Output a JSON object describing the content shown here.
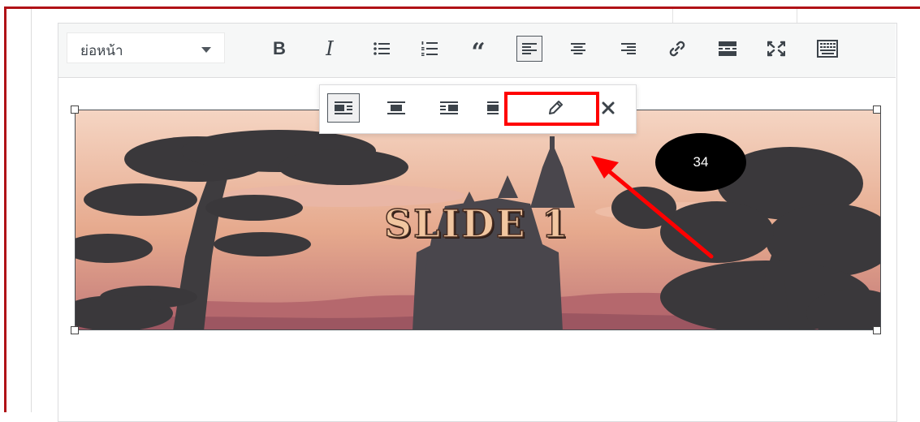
{
  "toolbar": {
    "format_select": {
      "value": "ย่อหน้า"
    },
    "buttons": [
      "bold-button",
      "italic-button",
      "bullet-list-button",
      "numbered-list-button",
      "blockquote-button",
      "align-left-button",
      "align-center-button",
      "align-right-button",
      "insert-link-button",
      "read-more-button",
      "fullscreen-button",
      "toolbar-toggle-button"
    ],
    "bold_glyph": "B",
    "italic_glyph": "I",
    "quote_glyph": "“"
  },
  "image_toolbar": {
    "buttons": [
      "align-left",
      "align-center",
      "align-right",
      "align-none",
      "edit",
      "remove"
    ],
    "active": "align-left"
  },
  "image": {
    "text": "SLIDE 1"
  },
  "annotation": {
    "step_number": "34",
    "highlight_color": "#ff0000",
    "arrow_color": "#ff0000"
  },
  "colors": {
    "frame": "#b01217",
    "toolbar_bg": "#f6f7f7",
    "icon": "#3c434a"
  }
}
